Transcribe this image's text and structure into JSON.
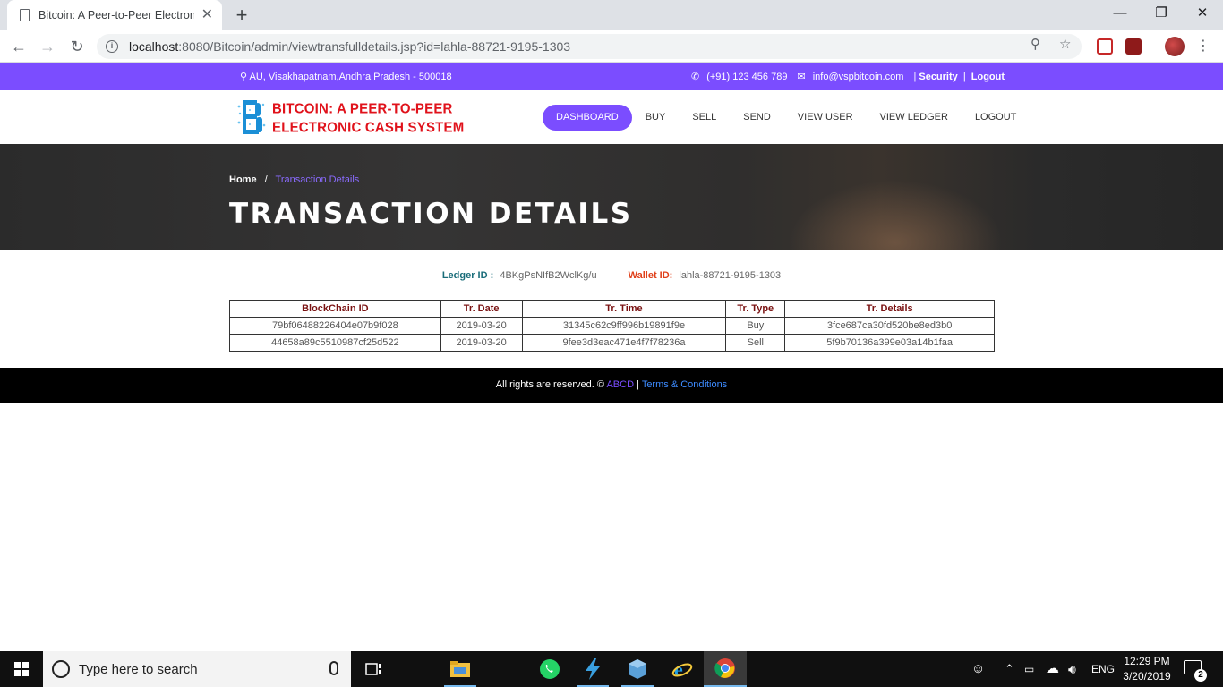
{
  "browser": {
    "tab_title": "Bitcoin: A Peer-to-Peer Electronic",
    "url_host": "localhost",
    "url_rest": ":8080/Bitcoin/admin/viewtransfulldetails.jsp?id=lahla-88721-9195-1303"
  },
  "topbar": {
    "location": "AU, Visakhapatnam,Andhra Pradesh - 500018",
    "phone": "(+91) 123 456 789",
    "email": "info@vspbitcoin.com",
    "security": "Security",
    "logout": "Logout"
  },
  "logo": {
    "line1": "BITCOIN: A PEER-TO-PEER",
    "line2": "ELECTRONIC CASH SYSTEM",
    "brand_color": "#e0121b"
  },
  "nav": {
    "items": [
      "DASHBOARD",
      "BUY",
      "SELL",
      "SEND",
      "VIEW USER",
      "VIEW LEDGER",
      "LOGOUT"
    ],
    "active": "DASHBOARD",
    "accent": "#7b4dff"
  },
  "banner": {
    "breadcrumb_home": "Home",
    "breadcrumb_sep": "/",
    "breadcrumb_current": "Transaction Details",
    "title": "TRANSACTION DETAILS"
  },
  "ids": {
    "ledger_label": "Ledger ID :",
    "ledger_value": "4BKgPsNIfB2WclKg/u",
    "wallet_label": "Wallet ID:",
    "wallet_value": "lahla-88721-9195-1303"
  },
  "table": {
    "headers": [
      "BlockChain ID",
      "Tr. Date",
      "Tr. Time",
      "Tr. Type",
      "Tr. Details"
    ],
    "rows": [
      [
        "79bf06488226404e07b9f028",
        "2019-03-20",
        "31345c62c9ff996b19891f9e",
        "Buy",
        "3fce687ca30fd520be8ed3b0"
      ],
      [
        "44658a89c5510987cf25d522",
        "2019-03-20",
        "9fee3d3eac471e4f7f78236a",
        "Sell",
        "5f9b70136a399e03a14b1faa"
      ]
    ]
  },
  "footer": {
    "rights": "All rights are reserved. ©",
    "brand": "ABCD",
    "sep": "|",
    "terms": "Terms & Conditions"
  },
  "taskbar": {
    "search_placeholder": "Type here to search",
    "language": "ENG",
    "time": "12:29 PM",
    "date": "3/20/2019",
    "notification_count": "2"
  }
}
